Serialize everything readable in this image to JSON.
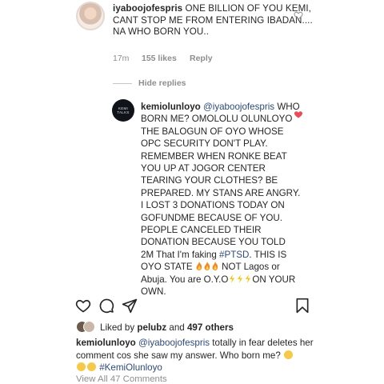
{
  "comment": {
    "username": "iyaboojofespris",
    "text": "ONE BILLION OF YOU KEMI, CANT STOP ME FROM ENTERING IBADAN.... NA WHO BORN YOU..",
    "time": "17m",
    "likes": "155 likes",
    "reply_label": "Reply"
  },
  "hide_replies": "Hide replies",
  "reply": {
    "username": "kemiolunloyo",
    "avatar_text": "KEMI TALKS",
    "mention": "@iyaboojofespris",
    "body_1": "WHO BORN ME? OMOLOLU OLUNLOYO THE BALOGUN OF OYO WHOSE OPC SECURITY DON'T PLAY. REMEMBER WHEN RONKE BEAT YOU UP AT JOGOR CENTER TEARING YOUR CLOTHES? BE PREPARED. MY STANS ARE ANGRY. I LOST 3 DONATIONS TODAY ON GOFUNDME BECAUSE OF YOU. PEOPLE CANCELED THEIR DONATION BECAUSE YOU TOLD 2M That I'm faking ",
    "hashtag": "#PTSD",
    "body_2": ". THIS IS OYO STATE",
    "body_3": "NOT Lagos or Abuja. You are O.Y.O",
    "body_4": "ON YOUR OWN."
  },
  "post": {
    "liked_by_prefix": "Liked by",
    "liked_by_user": "pelubz",
    "liked_by_and": "and",
    "liked_by_others": "497 others",
    "caption_user": "kemiolunloyo",
    "caption_mention": "@iyaboojofespris",
    "caption_text": " totally in fear deletes her comment cos she saw my answer. Who born me?",
    "caption_hashtag": "#KemiOlunloyo",
    "view_all": "View All 47 Comments"
  },
  "icons": {
    "comment_heart": "heart-outline-icon",
    "reply_heart": "heart-filled-icon",
    "like": "heart-outline-icon",
    "comment": "comment-bubble-icon",
    "share": "paper-plane-icon",
    "save": "bookmark-icon"
  },
  "colors": {
    "reply_heart": "#ed4956",
    "mention": "#2e4a7d",
    "muted": "#8e8e8e"
  }
}
